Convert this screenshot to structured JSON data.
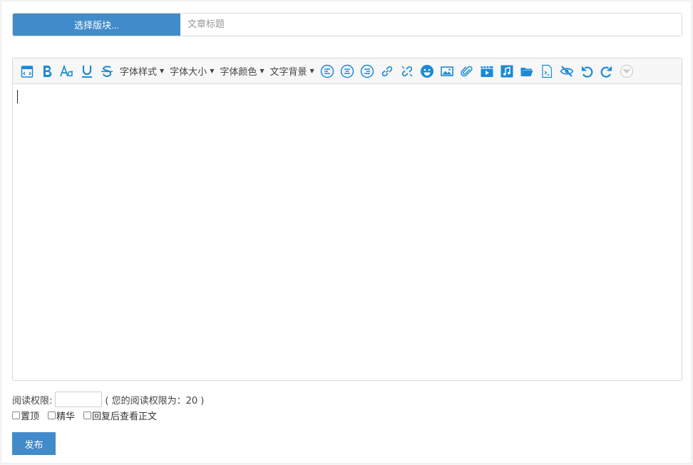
{
  "header": {
    "section_button_label": "选择版块...",
    "title_placeholder": "文章标题",
    "title_value": ""
  },
  "toolbar": {
    "icons_left": [
      "source-code-icon",
      "bold-icon",
      "font-face-icon",
      "underline-icon",
      "strikethrough-icon"
    ],
    "dropdowns": [
      {
        "label": "字体样式"
      },
      {
        "label": "字体大小"
      },
      {
        "label": "字体颜色"
      },
      {
        "label": "文字背景"
      }
    ],
    "icons_right": [
      "align-left-icon",
      "align-center-icon",
      "align-right-icon",
      "insert-link-icon",
      "unlink-icon",
      "emoticon-icon",
      "insert-image-icon",
      "attachment-icon",
      "insert-video-icon",
      "insert-music-icon",
      "folder-icon",
      "code-file-icon",
      "hide-content-icon",
      "undo-icon",
      "redo-icon",
      "fullscreen-icon"
    ],
    "accent": "#1a8ad4"
  },
  "editor": {
    "content": ""
  },
  "permission": {
    "label": "阅读权限:",
    "value": "",
    "note": "( 您的阅读权限为：20 )"
  },
  "options": [
    {
      "label": "置顶",
      "checked": false
    },
    {
      "label": "精华",
      "checked": false
    },
    {
      "label": "回复后查看正文",
      "checked": false
    }
  ],
  "publish_label": "发布",
  "colors": {
    "primary": "#428bca",
    "icon_blue": "#1a8ad4"
  }
}
